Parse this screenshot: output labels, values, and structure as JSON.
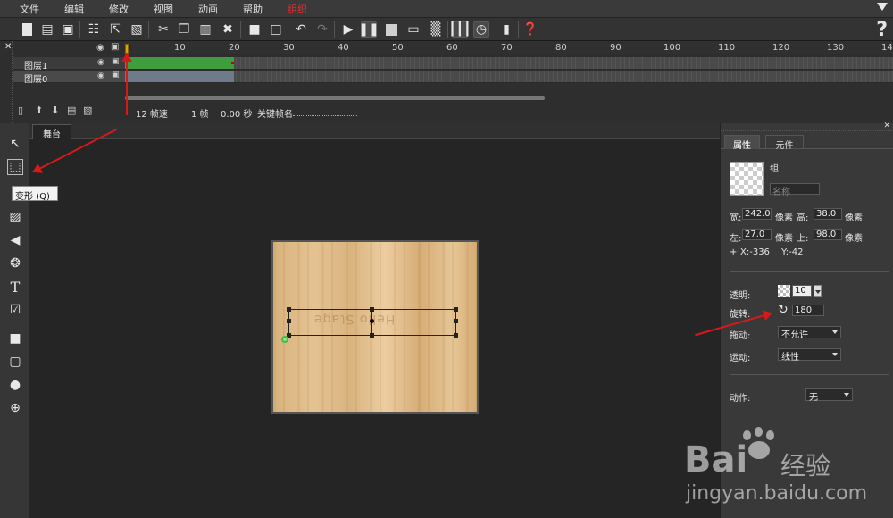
{
  "menu": {
    "items": [
      "文件",
      "编辑",
      "修改",
      "视图",
      "动画",
      "帮助",
      "组织"
    ],
    "active_index": 6
  },
  "toolbar": {
    "icons": [
      "new-file-icon",
      "open-folder-icon",
      "save-icon",
      "grid-icon",
      "export-icon",
      "library-icon",
      "cut-icon",
      "copy-icon",
      "paste-icon",
      "delete-icon",
      "lock-icon",
      "unlock-icon",
      "undo-icon",
      "redo-icon",
      "play-icon",
      "pause-icon",
      "stop-icon",
      "preview-icon",
      "qr-icon",
      "frames-icon",
      "timer-icon",
      "battery-icon",
      "help-icon"
    ]
  },
  "timeline": {
    "ruler_ticks": [
      "1",
      "10",
      "20",
      "30",
      "40",
      "50",
      "60",
      "70",
      "80",
      "90",
      "100",
      "110",
      "120",
      "130",
      "14"
    ],
    "layers": [
      {
        "name": "图层1",
        "selected": false,
        "frames_color": "#3f9c3f"
      },
      {
        "name": "图层0",
        "selected": true,
        "frames_color": "#6f7a8a"
      }
    ],
    "status": {
      "fps": "12 帧速",
      "frame": "1 帧",
      "time": "0.00 秒",
      "keyframe_label": "关键帧名"
    }
  },
  "stage": {
    "tab": "舞台",
    "tooltip": "变形 (Q)"
  },
  "properties": {
    "tabs": [
      "属性",
      "元件"
    ],
    "active_tab": 0,
    "object_type": "组",
    "name_placeholder": "名称",
    "width_label": "宽:",
    "width": "242.0",
    "height_label": "高:",
    "height": "38.0",
    "left_label": "左:",
    "left": "27.0",
    "top_label": "上:",
    "top": "98.0",
    "unit": "像素",
    "x_coord": "X:-336",
    "y_coord": "Y:-42",
    "plus": "+",
    "opacity_label": "透明:",
    "opacity": "10",
    "rotation_label": "旋转:",
    "rotation": "180",
    "drag_label": "拖动:",
    "drag": "不允许",
    "motion_label": "运动:",
    "motion": "线性",
    "action_label": "动作:",
    "action": "无"
  },
  "watermark": {
    "brand_left": "Bai",
    "brand_right": "经验",
    "url": "jingyan.baidu.com"
  },
  "colors": {
    "accent_red": "#d41a1a",
    "frames_green": "#3f9c3f",
    "active_menu": "#e03030"
  }
}
